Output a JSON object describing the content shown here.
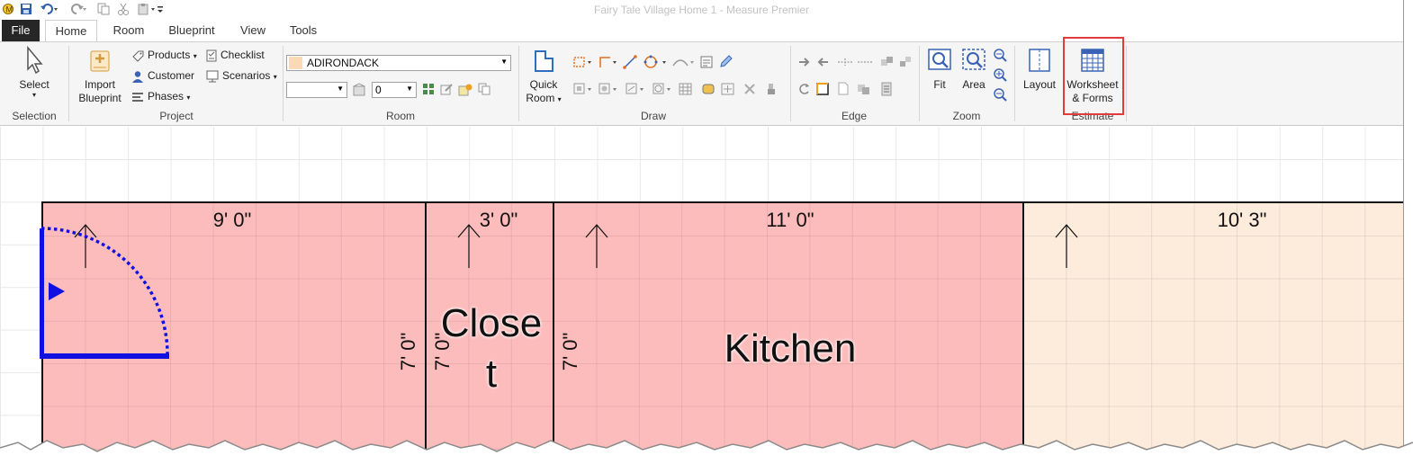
{
  "window": {
    "title": "Fairy Tale Village Home 1 - Measure Premier"
  },
  "tabs": [
    "File",
    "Home",
    "Room",
    "Blueprint",
    "View",
    "Tools"
  ],
  "ribbon": {
    "selection": {
      "select_label": "Select",
      "group_label": "Selection"
    },
    "project": {
      "import_label_1": "Import",
      "import_label_2": "Blueprint",
      "products": "Products",
      "checklist": "Checklist",
      "customer": "Customer",
      "scenarios": "Scenarios",
      "phases": "Phases",
      "group_label": "Project"
    },
    "room": {
      "product_value": "ADIRONDACK",
      "style_value": "",
      "number_value": "0",
      "group_label": "Room"
    },
    "draw": {
      "quick_room_1": "Quick",
      "quick_room_2": "Room",
      "group_label": "Draw"
    },
    "edge": {
      "group_label": "Edge"
    },
    "zoom": {
      "fit": "Fit",
      "area": "Area",
      "group_label": "Zoom"
    },
    "estimate": {
      "layout": "Layout",
      "worksheet_1": "Worksheet",
      "worksheet_2": "& Forms",
      "group_label": "Estimate"
    }
  },
  "colors": {
    "room_selected": "#fdbcbc",
    "room_unselected": "#fdecdc",
    "door": "#1010e0",
    "highlight": "#e23b3b"
  },
  "rooms": [
    {
      "width_dim": "9' 0\"",
      "height_dim": "7' 0\"",
      "name": ""
    },
    {
      "width_dim": "3' 0\"",
      "height_dim": "7' 0\"",
      "name_line1": "Close",
      "name_line2": "t"
    },
    {
      "width_dim": "11' 0\"",
      "height_dim": "7' 0\"",
      "name": "Kitchen"
    },
    {
      "width_dim": "10' 3\"",
      "name": ""
    }
  ]
}
